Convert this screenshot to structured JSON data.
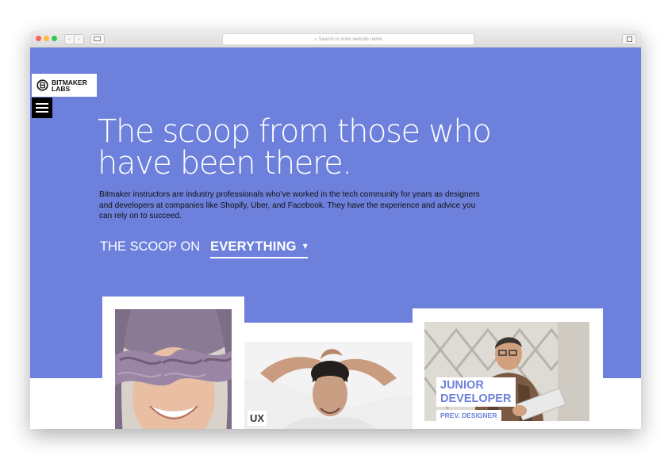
{
  "browser": {
    "address_placeholder": "Search or enter website name"
  },
  "site": {
    "logo_line1": "BITMAKER",
    "logo_line2": "LABS"
  },
  "hero": {
    "headline_line1": "The scoop from those who",
    "headline_line2": "have been there.",
    "intro_line1": "Bitmaker instructors are industry professionals who’ve worked in the tech community for years as designers",
    "intro_line2": "and developers at companies like Shopify, Uber, and Facebook. They have the experience and advice you",
    "intro_line3": "can rely on to succeed.",
    "scoop_prefix": "THE SCOOP ON",
    "scoop_selected": "EVERYTHING"
  },
  "cards": [
    {
      "label": ""
    },
    {
      "label": "UX"
    },
    {
      "title_line1": "JUNIOR",
      "title_line2": "DEVELOPER",
      "subtitle": "PREV. DESIGNER"
    }
  ],
  "colors": {
    "hero_background": "#6c80dc",
    "accent_text": "#6c80dc"
  },
  "icons": [
    "bitmaker-logo-icon",
    "hamburger-menu-icon",
    "dropdown-caret-icon",
    "search-icon"
  ]
}
